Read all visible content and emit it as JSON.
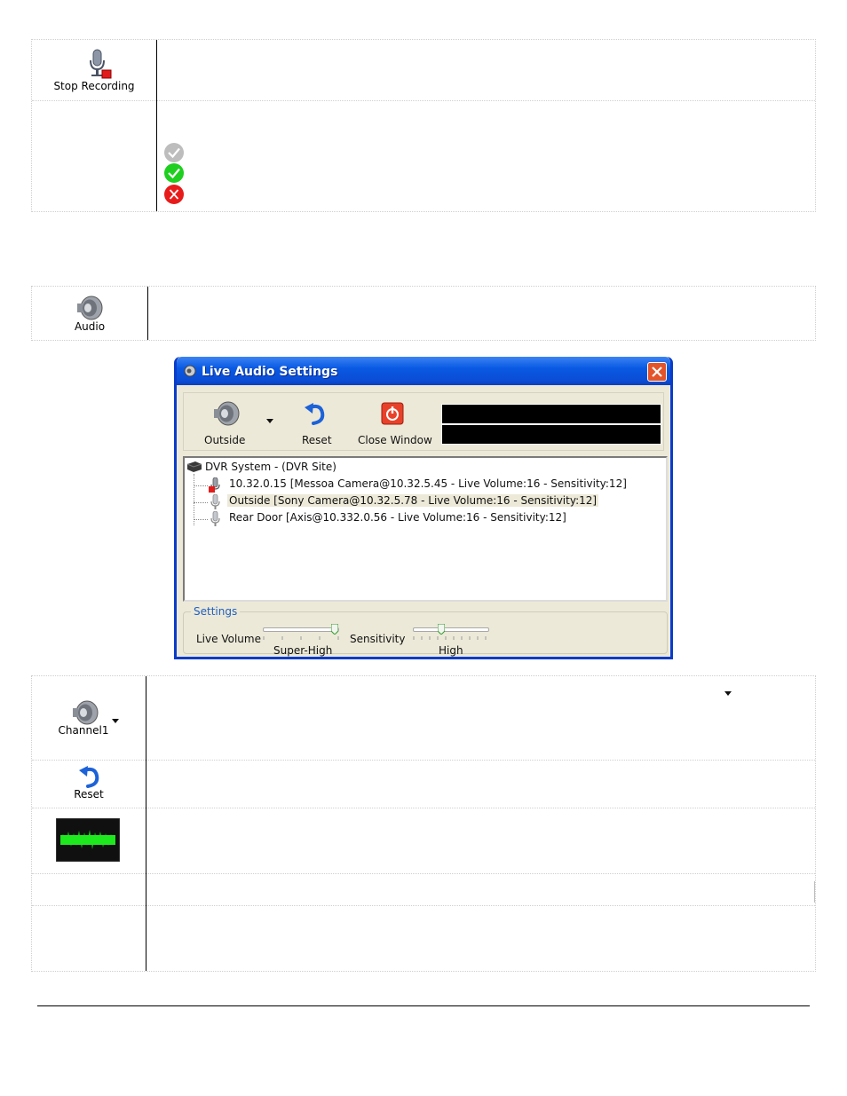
{
  "table1": {
    "stop_recording_label": "Stop Recording",
    "status_icons": [
      "gray-check-icon",
      "green-check-icon",
      "red-x-icon"
    ]
  },
  "table2": {
    "audio_label": "Audio"
  },
  "window": {
    "title": "Live Audio Settings",
    "toolbar": {
      "outside_label": "Outside",
      "reset_label": "Reset",
      "close_label": "Close Window"
    },
    "tree": {
      "root": "DVR System - (DVR Site)",
      "items": [
        "10.32.0.15 [Messoa Camera@10.32.5.45 - Live Volume:16 - Sensitivity:12]",
        "Outside [Sony Camera@10.32.5.78 - Live Volume:16 - Sensitivity:12]",
        "Rear Door [Axis@10.332.0.56 - Live Volume:16 - Sensitivity:12]"
      ]
    },
    "settings": {
      "legend": "Settings",
      "volume_label": "Live Volume",
      "volume_value": "Super-High",
      "volume_level": 1.0,
      "sensitivity_label": "Sensitivity",
      "sensitivity_value": "High",
      "sensitivity_level": 0.4
    }
  },
  "table3": {
    "channel_label": "Channel1",
    "reset_label": "Reset"
  },
  "colors": {
    "title_bar": "#0a5ae3",
    "close_red": "#e3542a",
    "waveform_green": "#1ee81e",
    "check_green": "#1fcf1f",
    "x_red": "#e81b1b"
  }
}
